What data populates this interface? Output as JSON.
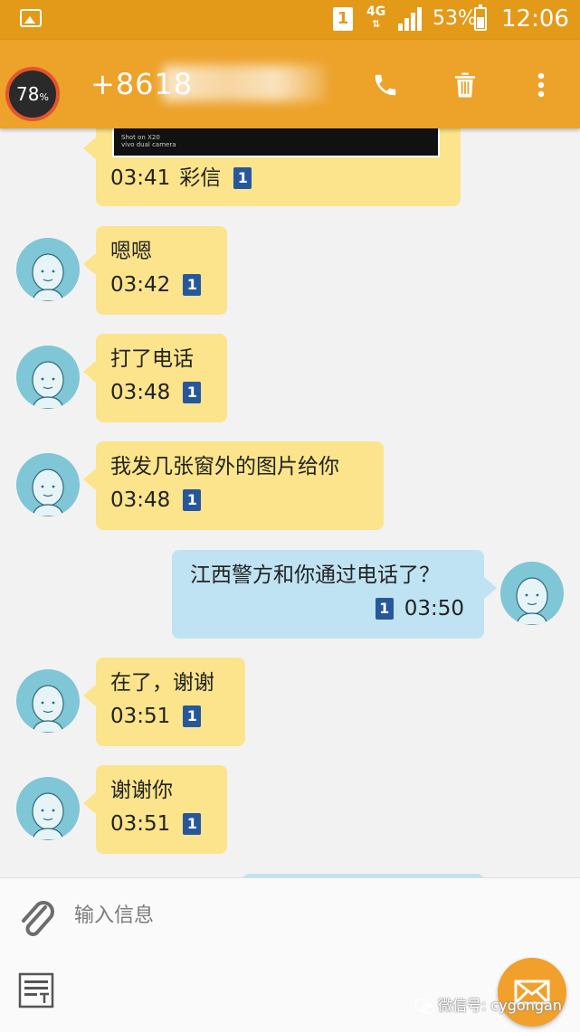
{
  "status_bar": {
    "sim": "1",
    "network": "4G",
    "battery": "53%",
    "time": "12:06"
  },
  "header": {
    "gauge": "78",
    "gauge_unit": "%",
    "contact": "+8618"
  },
  "messages": [
    {
      "direction": "in",
      "text": "",
      "time": "03:41",
      "type_label": "彩信",
      "sim": "1"
    },
    {
      "direction": "in",
      "text": "嗯嗯",
      "time": "03:42",
      "sim": "1"
    },
    {
      "direction": "in",
      "text": "打了电话",
      "time": "03:48",
      "sim": "1"
    },
    {
      "direction": "in",
      "text": "我发几张窗外的图片给你",
      "time": "03:48",
      "sim": "1"
    },
    {
      "direction": "out",
      "text": "江西警方和你通过电话了？",
      "time": "03:50",
      "sim": "1"
    },
    {
      "direction": "in",
      "text": "在了，谢谢",
      "time": "03:51",
      "sim": "1"
    },
    {
      "direction": "in",
      "text": "谢谢你",
      "time": "03:51",
      "sim": "1"
    }
  ],
  "photo_caption": "Shot on X20\nvivo dual camera",
  "compose": {
    "placeholder": "输入信息"
  },
  "watermark": "微信号: cygongan",
  "colors": {
    "status_bar": "#e39a19",
    "app_bar": "#eda22a",
    "incoming_bubble": "#fbe48b",
    "outgoing_bubble": "#bfe3f2",
    "sim_badge": "#27579b",
    "send_button": "#f0a02b"
  }
}
